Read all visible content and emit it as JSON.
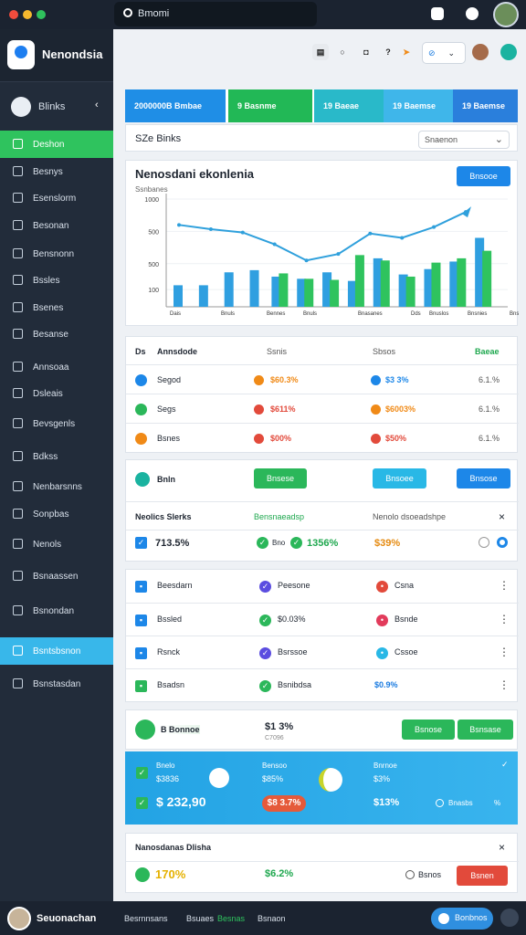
{
  "window": {
    "dots": [
      "#f24c3d",
      "#f5b82e",
      "#2fc15c"
    ]
  },
  "search": {
    "text": "Bmomi"
  },
  "brand": {
    "name": "Nenondsia"
  },
  "workspace": {
    "label": "Blinks",
    "chevron": "‹"
  },
  "sidebar": {
    "items": [
      {
        "label": "Deshon",
        "icon": "dashboard-icon",
        "state": "active"
      },
      {
        "label": "Besnys",
        "icon": "folder-icon"
      },
      {
        "label": "Esenslorm",
        "icon": "terminal-icon"
      },
      {
        "label": "Besonan",
        "icon": "share-icon"
      },
      {
        "label": "Bensnonn",
        "icon": "mail-icon"
      },
      {
        "label": "Bssles",
        "icon": "columns-icon"
      },
      {
        "label": "Bsenes",
        "icon": "pen-icon"
      },
      {
        "label": "Besanse",
        "icon": "card-icon"
      },
      {
        "label": "Annsoaa",
        "icon": "chart-icon"
      },
      {
        "label": "Dsleais",
        "icon": "window-icon"
      },
      {
        "label": "Bevsgenls",
        "icon": "list-icon"
      },
      {
        "label": "Bdkss",
        "icon": "grid-icon"
      },
      {
        "label": "Nenbarsnns",
        "icon": "warning-icon"
      },
      {
        "label": "Sonpbas",
        "icon": "book-icon"
      },
      {
        "label": "Nenols",
        "icon": "lock-icon"
      },
      {
        "label": "Bsnaassen",
        "icon": "coin-icon"
      },
      {
        "label": "Bsnondan",
        "icon": "target-icon"
      },
      {
        "label": "Bsntsbsnon",
        "icon": "image-icon",
        "state": "selected"
      },
      {
        "label": "Bsnstasdan",
        "icon": "shield-icon"
      }
    ]
  },
  "header": {
    "icons": [
      "inbox-icon",
      "dot-icon",
      "bell-icon",
      "help-icon",
      "bolt-icon"
    ],
    "pill_left": "⊘",
    "pill_right": "⌄"
  },
  "kpis": [
    {
      "label": "2000000B Bmbae",
      "color": "#1f8ee6"
    },
    {
      "label": "9  Basnme",
      "color": "#22b856"
    },
    {
      "label": "19  Baeae",
      "color": "#29b9c9"
    },
    {
      "label": "19  Baemse",
      "color": "#3fb6ea"
    },
    {
      "label": "19  Baemse",
      "color": "#2a7fdc"
    }
  ],
  "filter": {
    "title": "SZe Binks",
    "select": "Snaenon",
    "chevron": "⌄"
  },
  "chart_data": {
    "type": "bar",
    "title": "Nenosdani ekonlenia",
    "subtitle": "Ssnbanes",
    "button": "Bnsooe",
    "y_ticks": [
      "1000",
      "500",
      "500",
      "100"
    ],
    "ylim": [
      0,
      1000
    ],
    "x_labels": [
      "Dais",
      "Bnuls",
      "Bennes",
      "Bnuls",
      "Bnasanes",
      "Dds",
      "Bnuslos",
      "Bnsnies",
      "Bnsanes"
    ],
    "series": [
      {
        "color": "#2f9fe0",
        "values": [
          200,
          200,
          320,
          340,
          280,
          260,
          320,
          240,
          450,
          300,
          350,
          420,
          640
        ]
      },
      {
        "color": "#2fc35e",
        "values": [
          0,
          0,
          0,
          0,
          310,
          260,
          250,
          480,
          430,
          280,
          410,
          450,
          520
        ]
      }
    ],
    "line": [
      760,
      720,
      690,
      580,
      430,
      490,
      680,
      640,
      740,
      880
    ],
    "line_color": "#2fa0dc"
  },
  "table1": {
    "headers": [
      "Annsdode",
      "Ssnis",
      "Sbsos",
      "Baeae"
    ],
    "head_icon": "Ds",
    "rows": [
      {
        "name": "Segod",
        "v1": "$60.3%",
        "v2": "$3 3%",
        "v3": "6.1.%",
        "icon_color": "#1d87e8",
        "c1": "#f08a17",
        "c2": "#1d87e8"
      },
      {
        "name": "Segs",
        "v1": "$611%",
        "v2": "$6003%",
        "v3": "6.1.%",
        "icon_color": "#2bb75a",
        "c1": "#e24a3b",
        "c2": "#f08a17"
      },
      {
        "name": "Bsnes",
        "v1": "$00%",
        "v2": "$50%",
        "v3": "6.1.%",
        "icon_color": "#f08a17",
        "c1": "#e24a3b",
        "c2": "#e24a3b"
      }
    ]
  },
  "actions": {
    "title": "Bnln",
    "buttons": [
      "Bnsese",
      "Bnsoee",
      "Bnsose"
    ],
    "sub_headers": [
      "Neolics Slerks",
      "Bensnaeadsp",
      "Nenolo dsoeadshpe"
    ],
    "close": "×",
    "values": [
      "713.5%",
      "Bno",
      "1356%",
      "$39%"
    ]
  },
  "list2": {
    "rows": [
      {
        "a": "Beesdarn",
        "b": "Peesone",
        "c": "Csna",
        "ia": "#1d87e8",
        "ib": "#5b4de0",
        "ic": "#e24a3b"
      },
      {
        "a": "Bssled",
        "b": "$0.03%",
        "c": "Bsnde",
        "ia": "#1d87e8",
        "ib": "#2bb75a",
        "ic": "#e23b5b"
      },
      {
        "a": "Rsnck",
        "b": "Bsrssoe",
        "c": "Cssoe",
        "ia": "#1d87e8",
        "ib": "#5b4de0",
        "ic": "#29b8e6"
      },
      {
        "a": "Bsadsn",
        "b": "Bsnibdsa",
        "c": "$0.9%",
        "ia": "#2bb75a",
        "ib": "#2bb75a",
        "ic": ""
      }
    ],
    "more": "⋮"
  },
  "promo": {
    "title": "B Bonnoe",
    "value": "$1 3%",
    "sub": "C7096",
    "buttons": [
      "Bsnose",
      "Bsnsase"
    ]
  },
  "blue_panel": {
    "col1": [
      "Bnelo",
      "$3836"
    ],
    "col2": [
      "Bensoo",
      "$85%",
      "Bnaon"
    ],
    "col3": [
      "Bnrnoe",
      "$3%",
      "$13%"
    ],
    "big": "$ 232,90",
    "pill": "$8 3.7%",
    "foot_r": "Bnasbs",
    "foot_r2": "%"
  },
  "footer_card": {
    "title": "Nanosdanas Dlisha",
    "close": "×",
    "value": "170%",
    "value2": "$6.2%",
    "link": "Bsnos",
    "button": "Bsnen"
  },
  "user": {
    "name": "Seuonachan",
    "links": [
      "Besrnnsans",
      "Bsuaes",
      "Besnas",
      "Bsnaon"
    ],
    "button": "Bonbnos"
  }
}
